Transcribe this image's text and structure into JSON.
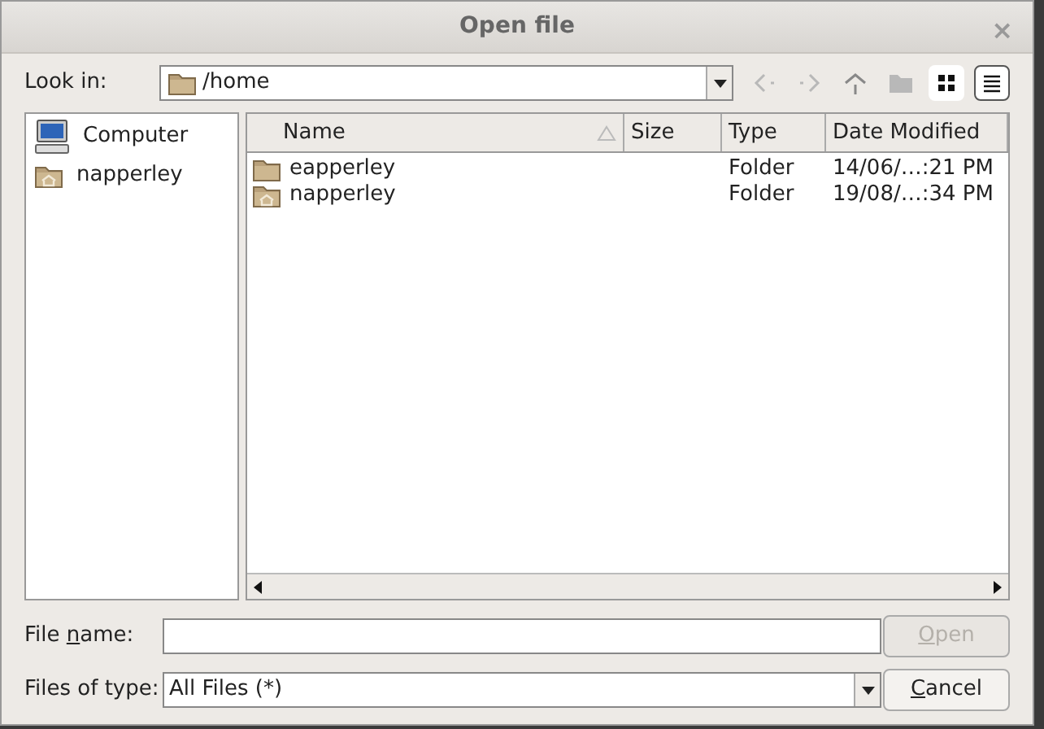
{
  "window": {
    "title": "Open file",
    "close": "×"
  },
  "look_in": {
    "label": "Look in:",
    "value": "/home"
  },
  "toolbar": [
    {
      "kind": "back",
      "disabled": true,
      "selected": false
    },
    {
      "kind": "forward",
      "disabled": true,
      "selected": false
    },
    {
      "kind": "up",
      "disabled": false,
      "selected": false
    },
    {
      "kind": "new-folder",
      "disabled": true,
      "selected": false
    },
    {
      "kind": "icon-view",
      "disabled": false,
      "selected": false
    },
    {
      "kind": "detail-view",
      "disabled": false,
      "selected": true
    }
  ],
  "sidebar": {
    "items": [
      {
        "kind": "computer",
        "label": "Computer",
        "selected": false
      },
      {
        "kind": "home",
        "label": "napperley",
        "selected": false
      }
    ]
  },
  "table": {
    "columns": [
      "Name",
      "Size",
      "Type",
      "Date Modified"
    ],
    "rows": [
      {
        "kind": "folder",
        "name": "eapperley",
        "type": "Folder",
        "date": "14/06/…:21 PM",
        "selected": false
      },
      {
        "kind": "home",
        "name": "napperley",
        "type": "Folder",
        "date": "19/08/…:34 PM",
        "selected": false
      }
    ]
  },
  "file_name": {
    "label_parts": [
      {
        "text": "File ",
        "underlined": false
      },
      {
        "text": "n",
        "underlined": true
      },
      {
        "text": "ame:",
        "underlined": false
      }
    ]
  },
  "file_type": {
    "label": "Files of type:",
    "value": "All Files (*)"
  },
  "buttons": [
    {
      "label_parts": [
        {
          "text": "O",
          "underlined": true
        },
        {
          "text": "pen",
          "underlined": false
        }
      ],
      "disabled": true
    },
    {
      "label_parts": [
        {
          "text": "C",
          "underlined": true
        },
        {
          "text": "ancel",
          "underlined": false
        }
      ],
      "disabled": false
    }
  ]
}
